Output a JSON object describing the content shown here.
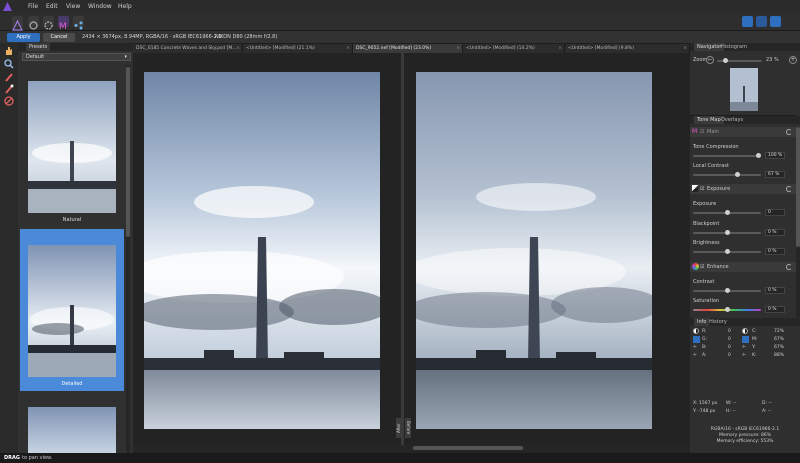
{
  "menu": {
    "items": [
      "File",
      "Edit",
      "View",
      "Window",
      "Help"
    ]
  },
  "context_bar": {
    "apply_label": "Apply",
    "cancel_label": "Cancel",
    "info": "2434 × 3674px, 8.94MP, RGBA/16 · sRGB IEC61966-2.1",
    "camera": "NIKON D80 (28mm f/2.8)"
  },
  "tabs": [
    {
      "label": "DSC_0185 Concrete Waves and Sky.psd [M..."
    },
    {
      "label": "<Untitled> [Modified] (21.1%)"
    },
    {
      "label": "DSC_9052.nef [Modified] (23.0%)"
    },
    {
      "label": "<Untitled> [Modified] (14.2%)"
    },
    {
      "label": "<Untitled> [Modified] (9.8%)"
    }
  ],
  "presets_panel": {
    "tab_label": "Presets",
    "dropdown_value": "Default",
    "presets": [
      {
        "name": "Natural"
      },
      {
        "name": "Detailed"
      }
    ]
  },
  "canvas": {
    "before_label": "After",
    "after_label": "Before"
  },
  "navigator": {
    "tabs": [
      "Navigator",
      "Histogram"
    ],
    "zoom_label": "Zoom:",
    "zoom_value": "23 %"
  },
  "tone_map": {
    "tabs": [
      "Tone Map",
      "Overlays"
    ],
    "main_section": "Main",
    "tone_compression_label": "Tone Compression",
    "tone_compression_value": "100 %",
    "tone_compression_level": 1.0,
    "local_contrast_label": "Local Contrast",
    "local_contrast_value": "67 %",
    "local_contrast_level": 0.67,
    "exposure_section": "Exposure",
    "exposure_label": "Exposure",
    "exposure_value": "0",
    "blackpoint_label": "Blackpoint",
    "blackpoint_value": "0 %",
    "brightness_label": "Brightness",
    "brightness_value": "0 %",
    "enhance_section": "Enhance",
    "contrast_label": "Contrast",
    "contrast_value": "0 %",
    "saturation_label": "Saturation",
    "saturation_value": "0 %"
  },
  "info_panel": {
    "tabs": [
      "Info",
      "History"
    ],
    "rgb": [
      {
        "k": "R:",
        "v": "0"
      },
      {
        "k": "G:",
        "v": "0"
      },
      {
        "k": "B:",
        "v": "0"
      },
      {
        "k": "A:",
        "v": "0"
      }
    ],
    "cmyk": [
      {
        "k": "C:",
        "v": "72%"
      },
      {
        "k": "M:",
        "v": "67%"
      },
      {
        "k": "Y:",
        "v": "67%"
      },
      {
        "k": "K:",
        "v": "88%"
      }
    ],
    "coords": {
      "x": "X: 1567 px",
      "y": "Y: -748 px",
      "w": "W: --",
      "h": "H: --",
      "d": "D: --",
      "a": "A: --"
    },
    "color_format": "RGBA/16 - sRGB IEC61966-2.1",
    "memory_pressure": "Memory pressure: 86%",
    "memory_efficiency": "Memory efficiency: 553%"
  },
  "status": {
    "key": "DRAG",
    "text": "to pan view."
  },
  "colors": {
    "accent": "#2f6fbf",
    "selected_preset": "#4a8ad8",
    "bg": "#1e1e1e"
  }
}
